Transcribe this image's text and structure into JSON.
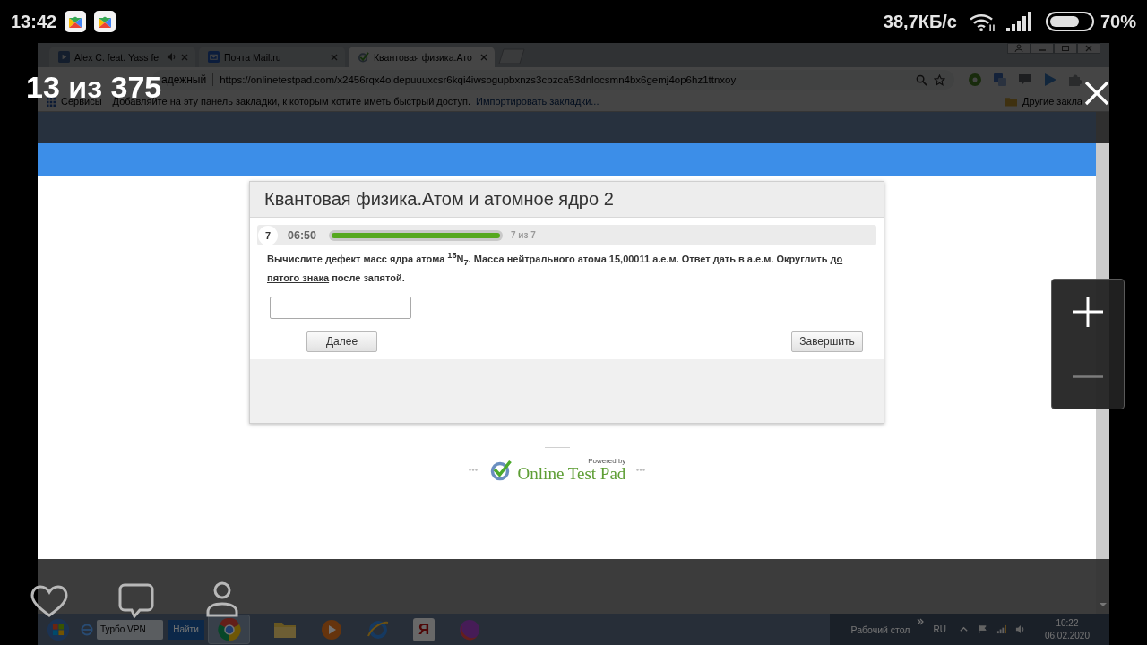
{
  "status_bar": {
    "time": "13:42",
    "network_speed": "38,7КБ/с",
    "battery": "70%"
  },
  "viewer": {
    "counter": "13 из 375",
    "zoom_buttons": [
      {
        "kind": "zoom_in",
        "disabled": false
      },
      {
        "kind": "zoom_out",
        "disabled": true
      }
    ]
  },
  "browser": {
    "tabs": [
      {
        "title": "Alex C. feat. Yass fe",
        "selected": false,
        "audio": true
      },
      {
        "title": "Почта Mail.ru",
        "selected": false,
        "audio": false
      },
      {
        "title": "Квантовая физика.Ато",
        "selected": true,
        "audio": false
      }
    ],
    "address_bar": {
      "security": "адежный",
      "url": "https://onlinetestpad.com/x2456rqx4oldepuuuxcsr6kqi4iwsogupbxnzs3cbzca53dnlocsmn4bx6gemj4op6hz1ttnxoy"
    },
    "bookmarks_bar": {
      "apps": "Сервисы",
      "hint": "Добавляйте на эту панель закладки, к которым хотите иметь быстрый доступ.",
      "import_link": "Импортировать закладки...",
      "other": "Другие закла"
    }
  },
  "test": {
    "title": "Квантовая физика.Атом и атомное ядро 2",
    "question_number": "7",
    "timer": "06:50",
    "progress": {
      "level": 1,
      "label": "7 из 7"
    },
    "question": [
      {
        "text": "Вычислите дефект масс ядра атома $^{15}$N$_{7}$. Масса нейтрального атома 15,00011 а.е.м. Ответ дать в а.е.м. Округлить ",
        "underlined": false
      },
      {
        "text": "до пятого знака",
        "underlined": true
      },
      {
        "text": " после запятой.",
        "underlined": false
      }
    ],
    "buttons": [
      {
        "kind": "next",
        "label": "Далее"
      },
      {
        "kind": "finish",
        "label": "Завершить"
      }
    ]
  },
  "footer": {
    "powered_by": "Powered by",
    "brand": "Online Test Pad"
  },
  "taskbar": {
    "search_placeholder": "Турбо VPN",
    "search_button": "Найти",
    "pinned_letter": "Я",
    "toolbar_label": "Рабочий стол",
    "language": "RU",
    "clock": "10:22",
    "date": "06.02.2020"
  }
}
